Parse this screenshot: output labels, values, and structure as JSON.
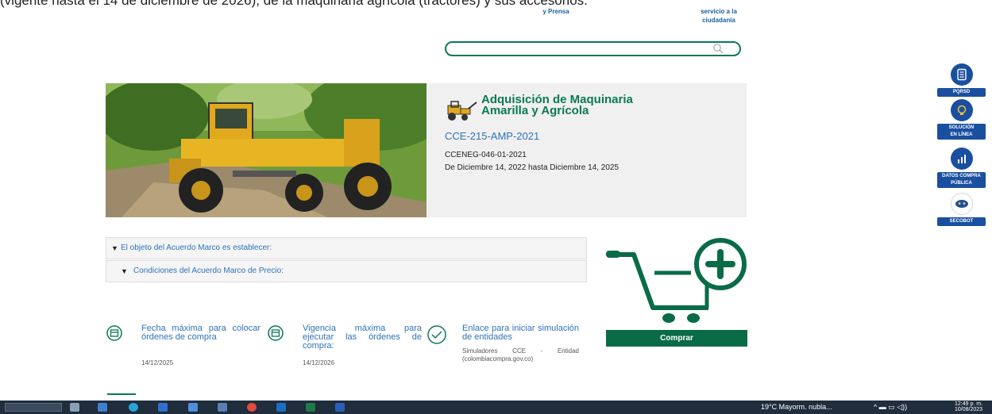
{
  "header": {
    "intro_text": "(vigente hasta el 14 de diciembre de 2026), de la maquinaria agrícola (tractores) y sus accesorios.",
    "nav_prensa": "y Prensa",
    "nav_servicio_1": "servicio a la",
    "nav_servicio_2": "ciudadanía"
  },
  "search": {
    "placeholder": "",
    "icon": "search-icon"
  },
  "hero": {
    "title_line1": "Adquisición de Maquinaria",
    "title_line2": "Amarilla y Agrícola",
    "code": "CCE-215-AMP-2021",
    "ref": "CCENEG-046-01-2021",
    "dates": "De Diciembre 14, 2022 hasta Diciembre 14, 2025",
    "accent_color": "#0a7a52",
    "link_color": "#2e73b8"
  },
  "accordion": {
    "item1": "El objeto del Acuerdo Marco es establecer:",
    "item2": "Condiciones del Acuerdo Marco de Precio:"
  },
  "buy_button": "Comprar",
  "info": {
    "fecha_label": "Fecha máxima para colocar órdenes de compra",
    "fecha_value": "14/12/2025",
    "vigencia_label": "Vigencia máxima para ejecutar las órdenes de compra:",
    "vigencia_value": "14/12/2026",
    "enlace_label": "Enlace para iniciar simulación de entidades",
    "enlace_value": "Simuladores CCE - Entidad (colombiacompra.gov.co)"
  },
  "sidebar": {
    "pqrsd": "PQRSD",
    "solucion_1": "SOLUCIÓN",
    "solucion_2": "EN LÍNEA",
    "datos_1": "DATOS COMPRA",
    "datos_2": "PÚBLICA",
    "secobot": "SECOBOT"
  },
  "taskbar": {
    "weather": "19°C Mayorm. nubla...",
    "time": "12:49 p. m.",
    "date": "10/08/2023"
  }
}
